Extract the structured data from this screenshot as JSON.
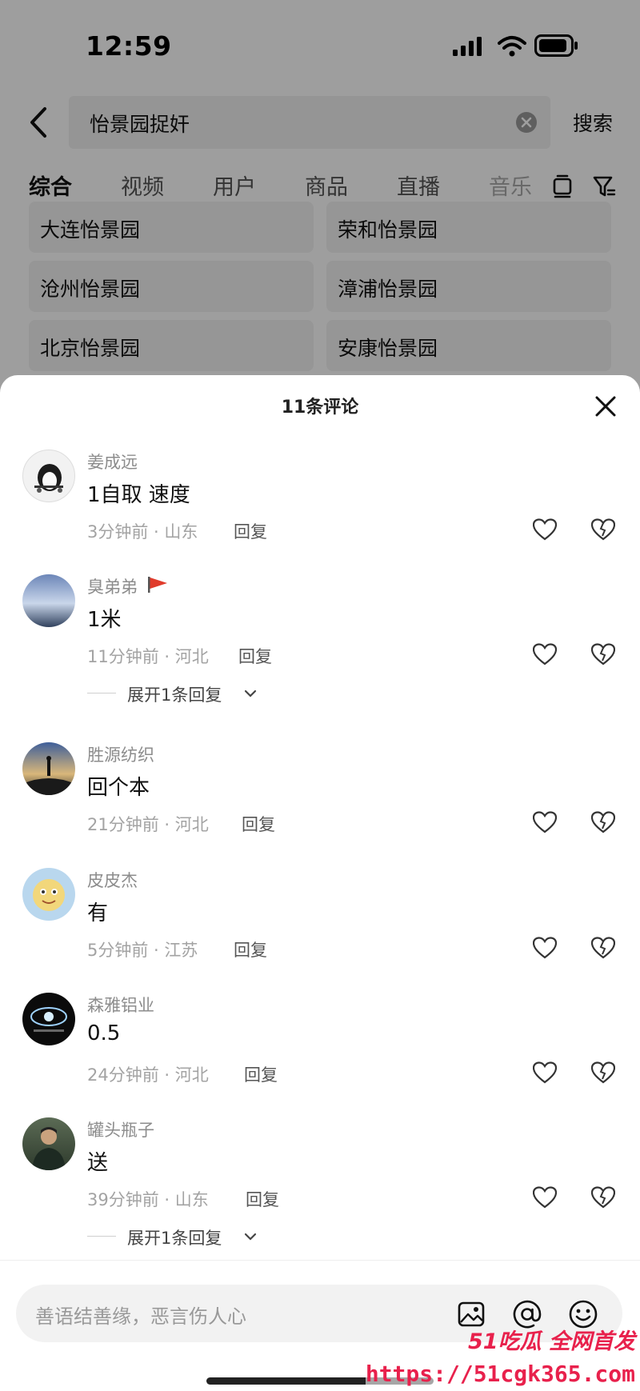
{
  "status_bar": {
    "time": "12:59"
  },
  "search": {
    "query": "怡景园捉奸",
    "submit_label": "搜索"
  },
  "tabs": [
    {
      "label": "综合",
      "active": true
    },
    {
      "label": "视频"
    },
    {
      "label": "用户"
    },
    {
      "label": "商品"
    },
    {
      "label": "直播"
    },
    {
      "label": "音乐"
    }
  ],
  "related_searches": [
    "大连怡景园",
    "荣和怡景园",
    "沧州怡景园",
    "漳浦怡景园",
    "北京怡景园",
    "安康怡景园"
  ],
  "sheet": {
    "title": "11条评论"
  },
  "comments": [
    {
      "user": "姜成远",
      "text": "1自取 速度",
      "meta": "3分钟前 · 山东",
      "reply_label": "回复"
    },
    {
      "user": "臭弟弟",
      "text": "1米",
      "meta": "11分钟前 · 河北",
      "reply_label": "回复",
      "expand_label": "展开1条回复"
    },
    {
      "user": "胜源纺织",
      "text": "回个本",
      "meta": "21分钟前 · 河北",
      "reply_label": "回复"
    },
    {
      "user": "皮皮杰",
      "text": "有",
      "meta": "5分钟前 · 江苏",
      "reply_label": "回复"
    },
    {
      "user": "森雅铝业",
      "text": "0.5",
      "meta": "24分钟前 · 河北",
      "reply_label": "回复"
    },
    {
      "user": "罐头瓶子",
      "text": "送",
      "meta": "39分钟前 · 山东",
      "reply_label": "回复",
      "expand_label": "展开1条回复"
    }
  ],
  "input": {
    "placeholder": "善语结善缘，恶言伤人心"
  },
  "watermark": {
    "brand": "51吃瓜 全网首发",
    "url": "https://51cgk365.com"
  },
  "colors": {
    "accent_flag": "#e03b2b",
    "watermark": "#e8214c"
  }
}
